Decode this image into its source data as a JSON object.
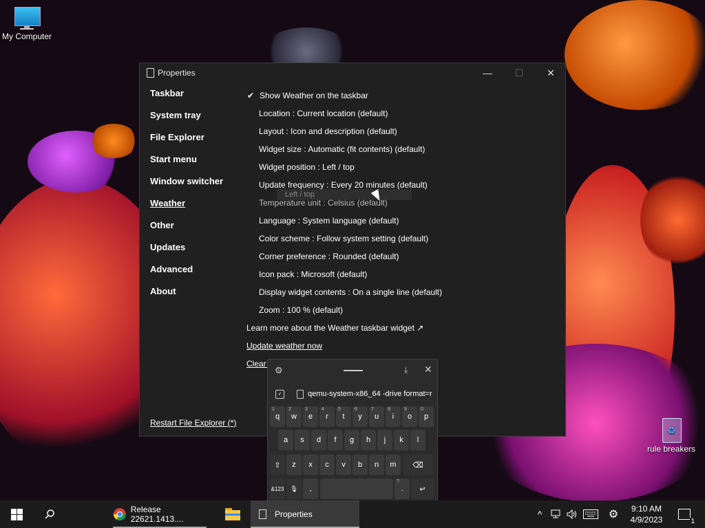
{
  "desktop": {
    "icons": [
      {
        "label": "My Computer"
      },
      {
        "label": "rule breakers"
      }
    ]
  },
  "window": {
    "title": "Properties",
    "controls": {
      "minimize": "—",
      "maximize": "☐",
      "close": "✕"
    },
    "nav": [
      {
        "label": "Taskbar",
        "active": false
      },
      {
        "label": "System tray",
        "active": false
      },
      {
        "label": "File Explorer",
        "active": false
      },
      {
        "label": "Start menu",
        "active": false
      },
      {
        "label": "Window switcher",
        "active": false
      },
      {
        "label": "Weather",
        "active": true
      },
      {
        "label": "Other",
        "active": false
      },
      {
        "label": "Updates",
        "active": false
      },
      {
        "label": "Advanced",
        "active": false
      },
      {
        "label": "About",
        "active": false
      }
    ],
    "settings": [
      {
        "label": "Show Weather on the taskbar",
        "checked": true,
        "check_glyph": "✔"
      },
      {
        "label": "Location : Current location (default)"
      },
      {
        "label": "Layout : Icon and description (default)"
      },
      {
        "label": "Widget size : Automatic (fit contents) (default)"
      },
      {
        "label": "Widget position : Left / top"
      },
      {
        "label": "Update frequency : Every 20 minutes (default)"
      },
      {
        "label": "Temperature unit : Celsius (default)"
      },
      {
        "label": "Language : System language (default)"
      },
      {
        "label": "Color scheme : Follow system setting (default)"
      },
      {
        "label": "Corner preference : Rounded (default)"
      },
      {
        "label": "Icon pack : Microsoft (default)"
      },
      {
        "label": "Display widget contents : On a single line (default)"
      },
      {
        "label": "Zoom : 100 % (default)"
      }
    ],
    "links": [
      {
        "label": "Learn more about the Weather taskbar widget ↗",
        "underline": false
      },
      {
        "label": "Update weather now",
        "underline": true
      },
      {
        "label": "Clear weather widget local data",
        "underline": true
      }
    ],
    "tooltip": "Left / top",
    "restart": "Restart File Explorer (*)"
  },
  "keyboard": {
    "icons": {
      "settings": "⚙",
      "dock": "⤓",
      "close": "✕",
      "clipboard": "✓",
      "backspace": "⌫",
      "shift": "⇧",
      "mic": "🎙",
      "enter": "↵"
    },
    "suggestion": "qemu-system-x86_64 -drive format=r",
    "row1": [
      {
        "key": "q",
        "sup": "1"
      },
      {
        "key": "w",
        "sup": "2"
      },
      {
        "key": "e",
        "sup": "3"
      },
      {
        "key": "r",
        "sup": "4"
      },
      {
        "key": "t",
        "sup": "5"
      },
      {
        "key": "y",
        "sup": "6"
      },
      {
        "key": "u",
        "sup": "7"
      },
      {
        "key": "i",
        "sup": "8"
      },
      {
        "key": "o",
        "sup": "9"
      },
      {
        "key": "p",
        "sup": "0"
      }
    ],
    "row2": [
      {
        "key": "a"
      },
      {
        "key": "s"
      },
      {
        "key": "d"
      },
      {
        "key": "f"
      },
      {
        "key": "g"
      },
      {
        "key": "h"
      },
      {
        "key": "j"
      },
      {
        "key": "k"
      },
      {
        "key": "l"
      }
    ],
    "row3": [
      {
        "key": "z"
      },
      {
        "key": "x"
      },
      {
        "key": "c"
      },
      {
        "key": "v"
      },
      {
        "key": "b"
      },
      {
        "key": "n"
      },
      {
        "key": "m"
      }
    ],
    "row4": {
      "symbols": "&123",
      "comma": ",",
      "period": ".",
      "period_sup": "?"
    }
  },
  "taskbar": {
    "items": [
      {
        "label": "Release 22621.1413...."
      },
      {
        "label": "Properties"
      }
    ],
    "tray": {
      "chevron": "^",
      "time": "9:10 AM",
      "date": "4/9/2023",
      "notifications": "1"
    }
  }
}
